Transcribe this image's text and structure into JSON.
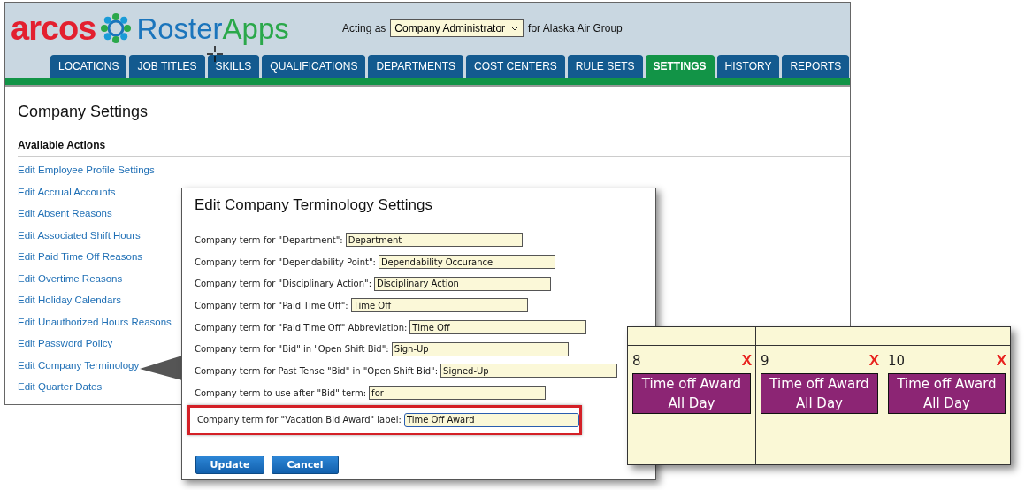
{
  "header": {
    "logo": {
      "brand": "arcos",
      "product_parts": [
        "Roster",
        "Apps"
      ]
    },
    "acting_as_label": "Acting as",
    "role_select": "Company Administrator",
    "company_text": "for Alaska Air Group"
  },
  "tabs": [
    {
      "label": "LOCATIONS",
      "selected": false
    },
    {
      "label": "JOB TITLES",
      "selected": false
    },
    {
      "label": "SKILLS",
      "selected": false
    },
    {
      "label": "QUALIFICATIONS",
      "selected": false
    },
    {
      "label": "DEPARTMENTS",
      "selected": false
    },
    {
      "label": "COST CENTERS",
      "selected": false
    },
    {
      "label": "RULE SETS",
      "selected": false
    },
    {
      "label": "SETTINGS",
      "selected": true
    },
    {
      "label": "HISTORY",
      "selected": false
    },
    {
      "label": "REPORTS",
      "selected": false
    }
  ],
  "page": {
    "title": "Company Settings",
    "section_title": "Available Actions",
    "actions": [
      "Edit Employee Profile Settings",
      "Edit Accrual Accounts",
      "Edit Absent Reasons",
      "Edit Associated Shift Hours",
      "Edit Paid Time Off Reasons",
      "Edit Overtime Reasons",
      "Edit Holiday Calendars",
      "Edit Unauthorized Hours Reasons",
      "Edit Password Policy",
      "Edit Company Terminology",
      "Edit Quarter Dates"
    ]
  },
  "dialog": {
    "title": "Edit Company Terminology Settings",
    "rows": [
      {
        "label": "Company term for \"Department\":",
        "value": "Department",
        "highlighted": false
      },
      {
        "label": "Company term for \"Dependability Point\":",
        "value": "Dependability Occurance",
        "highlighted": false
      },
      {
        "label": "Company term for \"Disciplinary Action\":",
        "value": "Disciplinary Action",
        "highlighted": false
      },
      {
        "label": "Company term for \"Paid Time Off\":",
        "value": "Time Off",
        "highlighted": false
      },
      {
        "label": "Company term for \"Paid Time Off\" Abbreviation:",
        "value": "Time Off",
        "highlighted": false
      },
      {
        "label": "Company term for \"Bid\" in \"Open Shift Bid\":",
        "value": "Sign-Up",
        "highlighted": false
      },
      {
        "label": "Company term for Past Tense \"Bid\" in \"Open Shift Bid\":",
        "value": "Signed-Up",
        "highlighted": false
      },
      {
        "label": "Company term to use after \"Bid\" term:",
        "value": "for",
        "highlighted": false
      },
      {
        "label": "Company term for \"Vacation Bid Award\" label:",
        "value": "Time Off Award",
        "highlighted": true
      }
    ],
    "buttons": [
      "Update",
      "Cancel"
    ]
  },
  "calendar": {
    "days": [
      {
        "number": "8",
        "remove": "X",
        "event": {
          "title": "Time off Award",
          "time": "All Day"
        }
      },
      {
        "number": "9",
        "remove": "X",
        "event": {
          "title": "Time off Award",
          "time": "All Day"
        }
      },
      {
        "number": "10",
        "remove": "X",
        "event": {
          "title": "Time off Award",
          "time": "All Day"
        }
      }
    ]
  }
}
